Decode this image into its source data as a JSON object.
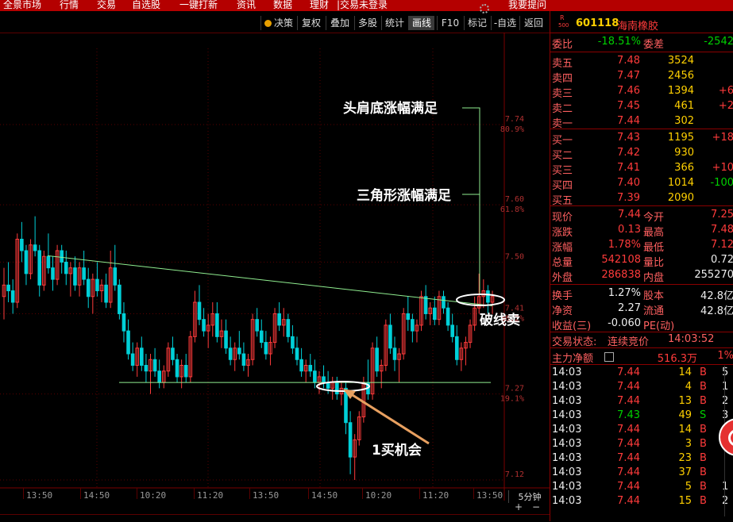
{
  "menu": [
    "全景市场",
    "行情",
    "交易",
    "自选股",
    "一键打新",
    "资讯",
    "数据",
    "理财",
    "|交易未登录",
    "我要提问"
  ],
  "toolbar": {
    "items": [
      "决策",
      "复权",
      "叠加",
      "多股",
      "统计",
      "画线",
      "F10",
      "标记",
      "-自选",
      "返回"
    ],
    "active": "画线"
  },
  "chart": {
    "price_labels": [
      {
        "price": "7.74",
        "pct": "80.9%"
      },
      {
        "price": "7.60",
        "pct": "61.8%"
      },
      {
        "price": "7.50",
        "pct": ""
      },
      {
        "price": "7.41",
        "pct": "38.2%"
      },
      {
        "price": "7.27",
        "pct": "19.1%"
      },
      {
        "price": "7.12",
        "pct": ""
      }
    ],
    "annotations": {
      "head_shoulders": "头肩底涨幅满足",
      "triangle": "三角形涨幅满足",
      "break_sell": "破线卖",
      "buy_chance": "1买机会"
    },
    "time_labels": [
      "13:50",
      "14:50",
      "10:20",
      "11:20",
      "13:50",
      "14:50",
      "10:20",
      "11:20",
      "13:50"
    ],
    "period": "5分钟",
    "plus": "+",
    "minus": "−",
    "candles": [
      [
        7.44,
        7.49,
        7.4,
        7.46
      ],
      [
        7.46,
        7.5,
        7.43,
        7.45
      ],
      [
        7.45,
        7.47,
        7.41,
        7.43
      ],
      [
        7.43,
        7.55,
        7.42,
        7.54
      ],
      [
        7.54,
        7.57,
        7.5,
        7.52
      ],
      [
        7.52,
        7.53,
        7.46,
        7.48
      ],
      [
        7.48,
        7.54,
        7.47,
        7.53
      ],
      [
        7.53,
        7.58,
        7.51,
        7.52
      ],
      [
        7.52,
        7.53,
        7.44,
        7.46
      ],
      [
        7.46,
        7.52,
        7.45,
        7.51
      ],
      [
        7.51,
        7.55,
        7.48,
        7.49
      ],
      [
        7.49,
        7.51,
        7.45,
        7.47
      ],
      [
        7.47,
        7.53,
        7.46,
        7.52
      ],
      [
        7.52,
        7.53,
        7.48,
        7.5
      ],
      [
        7.5,
        7.52,
        7.46,
        7.48
      ],
      [
        7.48,
        7.5,
        7.44,
        7.49
      ],
      [
        7.49,
        7.51,
        7.45,
        7.46
      ],
      [
        7.46,
        7.5,
        7.44,
        7.49
      ],
      [
        7.49,
        7.52,
        7.46,
        7.47
      ],
      [
        7.47,
        7.49,
        7.42,
        7.44
      ],
      [
        7.44,
        7.48,
        7.41,
        7.47
      ],
      [
        7.47,
        7.5,
        7.44,
        7.45
      ],
      [
        7.45,
        7.47,
        7.43,
        7.46
      ],
      [
        7.46,
        7.48,
        7.42,
        7.43
      ],
      [
        7.43,
        7.52,
        7.42,
        7.49
      ],
      [
        7.49,
        7.53,
        7.45,
        7.46
      ],
      [
        7.46,
        7.47,
        7.4,
        7.41
      ],
      [
        7.41,
        7.43,
        7.36,
        7.38
      ],
      [
        7.38,
        7.4,
        7.33,
        7.34
      ],
      [
        7.34,
        7.36,
        7.31,
        7.32
      ],
      [
        7.32,
        7.36,
        7.3,
        7.35
      ],
      [
        7.35,
        7.37,
        7.31,
        7.32
      ],
      [
        7.32,
        7.34,
        7.29,
        7.31
      ],
      [
        7.31,
        7.34,
        7.27,
        7.33
      ],
      [
        7.33,
        7.35,
        7.3,
        7.31
      ],
      [
        7.31,
        7.33,
        7.28,
        7.29
      ],
      [
        7.29,
        7.32,
        7.28,
        7.31
      ],
      [
        7.31,
        7.36,
        7.3,
        7.35
      ],
      [
        7.35,
        7.37,
        7.32,
        7.33
      ],
      [
        7.33,
        7.34,
        7.29,
        7.3
      ],
      [
        7.3,
        7.33,
        7.28,
        7.32
      ],
      [
        7.32,
        7.34,
        7.29,
        7.3
      ],
      [
        7.3,
        7.38,
        7.29,
        7.37
      ],
      [
        7.37,
        7.45,
        7.36,
        7.43
      ],
      [
        7.43,
        7.46,
        7.39,
        7.4
      ],
      [
        7.4,
        7.42,
        7.37,
        7.38
      ],
      [
        7.38,
        7.41,
        7.35,
        7.39
      ],
      [
        7.39,
        7.43,
        7.37,
        7.41
      ],
      [
        7.41,
        7.43,
        7.36,
        7.37
      ],
      [
        7.37,
        7.4,
        7.35,
        7.38
      ],
      [
        7.38,
        7.4,
        7.34,
        7.35
      ],
      [
        7.35,
        7.37,
        7.32,
        7.33
      ],
      [
        7.33,
        7.36,
        7.31,
        7.35
      ],
      [
        7.35,
        7.38,
        7.33,
        7.34
      ],
      [
        7.34,
        7.36,
        7.31,
        7.32
      ],
      [
        7.32,
        7.34,
        7.3,
        7.33
      ],
      [
        7.33,
        7.41,
        7.32,
        7.4
      ],
      [
        7.4,
        7.42,
        7.37,
        7.38
      ],
      [
        7.38,
        7.4,
        7.35,
        7.36
      ],
      [
        7.36,
        7.38,
        7.33,
        7.34
      ],
      [
        7.34,
        7.37,
        7.32,
        7.36
      ],
      [
        7.36,
        7.42,
        7.35,
        7.41
      ],
      [
        7.41,
        7.43,
        7.38,
        7.39
      ],
      [
        7.39,
        7.42,
        7.37,
        7.4
      ],
      [
        7.4,
        7.41,
        7.36,
        7.37
      ],
      [
        7.37,
        7.39,
        7.34,
        7.35
      ],
      [
        7.35,
        7.37,
        7.32,
        7.33
      ],
      [
        7.33,
        7.35,
        7.3,
        7.31
      ],
      [
        7.31,
        7.33,
        7.29,
        7.32
      ],
      [
        7.32,
        7.34,
        7.3,
        7.31
      ],
      [
        7.31,
        7.33,
        7.28,
        7.29
      ],
      [
        7.29,
        7.31,
        7.27,
        7.3
      ],
      [
        7.3,
        7.32,
        7.28,
        7.29
      ],
      [
        7.29,
        7.31,
        7.27,
        7.28
      ],
      [
        7.28,
        7.3,
        7.26,
        7.29
      ],
      [
        7.29,
        7.3,
        7.26,
        7.27
      ],
      [
        7.27,
        7.29,
        7.25,
        7.28
      ],
      [
        7.28,
        7.29,
        7.2,
        7.22
      ],
      [
        7.22,
        7.24,
        7.13,
        7.16
      ],
      [
        7.16,
        7.2,
        7.12,
        7.19
      ],
      [
        7.19,
        7.24,
        7.18,
        7.23
      ],
      [
        7.23,
        7.3,
        7.22,
        7.29
      ],
      [
        7.29,
        7.33,
        7.26,
        7.27
      ],
      [
        7.27,
        7.36,
        7.26,
        7.35
      ],
      [
        7.35,
        7.37,
        7.3,
        7.31
      ],
      [
        7.31,
        7.33,
        7.28,
        7.32
      ],
      [
        7.32,
        7.4,
        7.31,
        7.39
      ],
      [
        7.39,
        7.41,
        7.34,
        7.35
      ],
      [
        7.35,
        7.37,
        7.31,
        7.33
      ],
      [
        7.33,
        7.35,
        7.29,
        7.34
      ],
      [
        7.34,
        7.42,
        7.33,
        7.41
      ],
      [
        7.41,
        7.44,
        7.38,
        7.4
      ],
      [
        7.4,
        7.41,
        7.36,
        7.38
      ],
      [
        7.38,
        7.4,
        7.36,
        7.39
      ],
      [
        7.39,
        7.45,
        7.38,
        7.44
      ],
      [
        7.44,
        7.46,
        7.4,
        7.41
      ],
      [
        7.41,
        7.43,
        7.39,
        7.42
      ],
      [
        7.42,
        7.44,
        7.39,
        7.4
      ],
      [
        7.4,
        7.45,
        7.39,
        7.44
      ],
      [
        7.44,
        7.45,
        7.41,
        7.42
      ],
      [
        7.42,
        7.43,
        7.38,
        7.39
      ],
      [
        7.39,
        7.41,
        7.36,
        7.37
      ],
      [
        7.37,
        7.39,
        7.32,
        7.33
      ],
      [
        7.33,
        7.36,
        7.31,
        7.35
      ],
      [
        7.35,
        7.37,
        7.32,
        7.36
      ],
      [
        7.36,
        7.4,
        7.35,
        7.39
      ],
      [
        7.39,
        7.44,
        7.38,
        7.42
      ],
      [
        7.42,
        7.48,
        7.41,
        7.44
      ],
      [
        7.44,
        7.47,
        7.42,
        7.45
      ],
      [
        7.45,
        7.46,
        7.41,
        7.43
      ],
      [
        7.43,
        7.45,
        7.41,
        7.44
      ]
    ]
  },
  "quote": {
    "header": {
      "r": "R",
      "num": "500",
      "code": "601118",
      "name": "海南橡胶"
    },
    "weibi": {
      "label": "委比",
      "value": "-18.51%",
      "label2": "委差",
      "value2": "-2542"
    },
    "asks": [
      {
        "label": "卖五",
        "price": "7.48",
        "vol": "3524",
        "extra": ""
      },
      {
        "label": "卖四",
        "price": "7.47",
        "vol": "2456",
        "extra": ""
      },
      {
        "label": "卖三",
        "price": "7.46",
        "vol": "1394",
        "extra": "+6"
      },
      {
        "label": "卖二",
        "price": "7.45",
        "vol": "461",
        "extra": "+2"
      },
      {
        "label": "卖一",
        "price": "7.44",
        "vol": "302",
        "extra": ""
      }
    ],
    "bids": [
      {
        "label": "买一",
        "price": "7.43",
        "vol": "1195",
        "extra": "+18"
      },
      {
        "label": "买二",
        "price": "7.42",
        "vol": "930",
        "extra": ""
      },
      {
        "label": "买三",
        "price": "7.41",
        "vol": "366",
        "extra": "+10"
      },
      {
        "label": "买四",
        "price": "7.40",
        "vol": "1014",
        "extra": "-100"
      },
      {
        "label": "买五",
        "price": "7.39",
        "vol": "2090",
        "extra": ""
      }
    ],
    "stats": [
      {
        "l1": "现价",
        "v1": "7.44",
        "l2": "今开",
        "v2": "7.25"
      },
      {
        "l1": "涨跌",
        "v1": "0.13",
        "l2": "最高",
        "v2": "7.48"
      },
      {
        "l1": "涨幅",
        "v1": "1.78%",
        "l2": "最低",
        "v2": "7.12"
      },
      {
        "l1": "总量",
        "v1": "542108",
        "l2": "量比",
        "v2": "0.72"
      },
      {
        "l1": "外盘",
        "v1": "286838",
        "l2": "内盘",
        "v2": "255270"
      }
    ],
    "stats2": [
      {
        "l1": "换手",
        "v1": "1.27%",
        "l2": "股本",
        "v2": "42.8亿"
      },
      {
        "l1": "净资",
        "v1": "2.27",
        "l2": "流通",
        "v2": "42.8亿"
      },
      {
        "l1": "收益(三)",
        "v1": "-0.060",
        "l2": "PE(动)",
        "v2": ""
      }
    ],
    "status": {
      "label": "交易状态:",
      "value": "连续竞价",
      "time": "14:03:52"
    },
    "main_flow": {
      "label": "主力净额",
      "value": "516.3万",
      "pct": "1%"
    },
    "ticks": [
      {
        "t": "14:03",
        "p": "7.44",
        "v": "14",
        "d": "B",
        "x": "5"
      },
      {
        "t": "14:03",
        "p": "7.44",
        "v": "4",
        "d": "B",
        "x": "1"
      },
      {
        "t": "14:03",
        "p": "7.44",
        "v": "13",
        "d": "B",
        "x": "2"
      },
      {
        "t": "14:03",
        "p": "7.43",
        "v": "49",
        "d": "S",
        "x": "3"
      },
      {
        "t": "14:03",
        "p": "7.44",
        "v": "14",
        "d": "B",
        "x": ""
      },
      {
        "t": "14:03",
        "p": "7.44",
        "v": "3",
        "d": "B",
        "x": ""
      },
      {
        "t": "14:03",
        "p": "7.44",
        "v": "23",
        "d": "B",
        "x": ""
      },
      {
        "t": "14:03",
        "p": "7.44",
        "v": "37",
        "d": "B",
        "x": ""
      },
      {
        "t": "14:03",
        "p": "7.44",
        "v": "5",
        "d": "B",
        "x": "1"
      },
      {
        "t": "14:03",
        "p": "7.44",
        "v": "15",
        "d": "B",
        "x": "2"
      }
    ]
  },
  "colors": {
    "up": "#ff3b3b",
    "down": "#00d0d8",
    "accent": "#ffd000",
    "line": "#90ee90"
  }
}
